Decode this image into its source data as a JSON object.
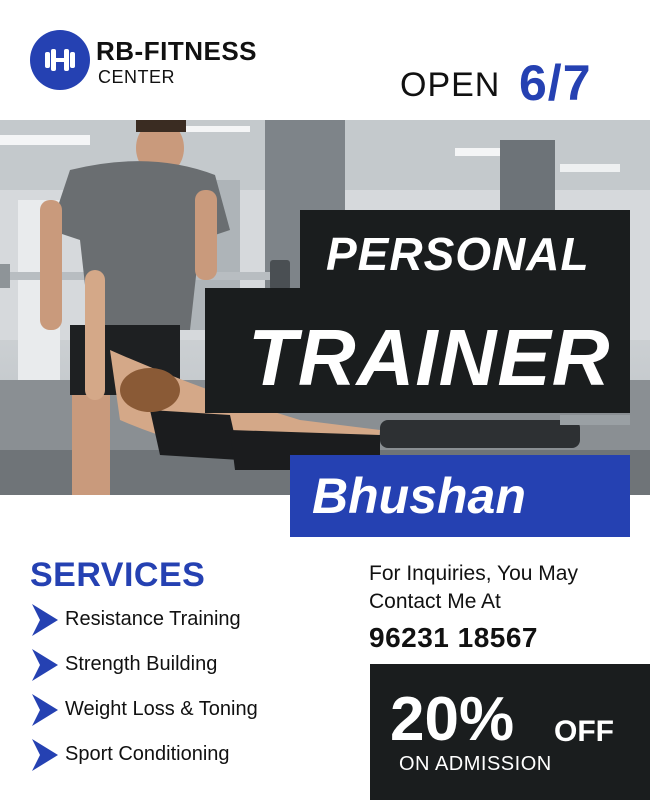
{
  "brand": {
    "line1": "RB-FITNESS",
    "line2": "CENTER",
    "logo_icon": "dumbbell-icon"
  },
  "hours": {
    "label": "OPEN",
    "days": "6/7"
  },
  "hero": {
    "line1": "PERSONAL",
    "line2": "TRAINER",
    "name": "Bhushan"
  },
  "services": {
    "title": "SERVICES",
    "items": [
      {
        "label": "Resistance Training"
      },
      {
        "label": "Strength Building"
      },
      {
        "label": "Weight Loss & Toning"
      },
      {
        "label": "Sport Conditioning"
      }
    ]
  },
  "contact": {
    "line1": "For Inquiries, You May",
    "line2": "Contact Me At",
    "phone": "96231 18567"
  },
  "offer": {
    "percent": "20%",
    "off": "OFF",
    "sub": "ON ADMISSION"
  },
  "colors": {
    "accent_blue": "#2541b2",
    "dark_panel": "#1a1d1e",
    "text_dark": "#111111",
    "background": "#ffffff"
  }
}
